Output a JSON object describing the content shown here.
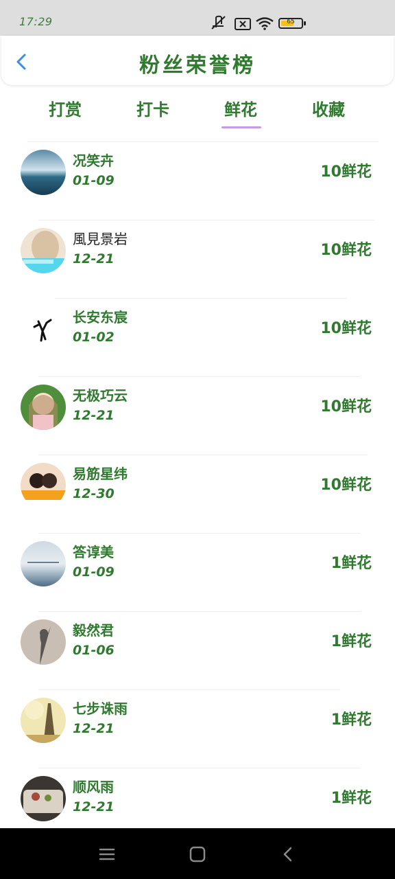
{
  "status_bar": {
    "time": "17:29",
    "battery_level": 65,
    "battery_text": "65",
    "icons": [
      "mute-icon",
      "no-sim-icon",
      "wifi-icon",
      "battery-icon"
    ]
  },
  "header": {
    "title": "粉丝荣誉榜",
    "back_icon": "chevron-left-icon"
  },
  "tabs": [
    {
      "label": "打赏",
      "active": false
    },
    {
      "label": "打卡",
      "active": false
    },
    {
      "label": "鲜花",
      "active": true
    },
    {
      "label": "收藏",
      "active": false
    }
  ],
  "fans": [
    {
      "name": "况笑卉",
      "date": "01-09",
      "amount": "10鲜花"
    },
    {
      "name": "風見景岩",
      "date": "12-21",
      "amount": "10鲜花"
    },
    {
      "name": "长安东宸",
      "date": "01-02",
      "amount": "10鲜花"
    },
    {
      "name": "无极巧云",
      "date": "12-21",
      "amount": "10鲜花"
    },
    {
      "name": "易筋星纬",
      "date": "12-30",
      "amount": "10鲜花"
    },
    {
      "name": "答谆美",
      "date": "01-09",
      "amount": "1鲜花"
    },
    {
      "name": "毅然君",
      "date": "01-06",
      "amount": "1鲜花"
    },
    {
      "name": "七步诛雨",
      "date": "12-21",
      "amount": "1鲜花"
    },
    {
      "name": "顺风雨",
      "date": "12-21",
      "amount": "1鲜花"
    }
  ],
  "nav": {
    "menu_icon": "menu-icon",
    "home_icon": "home-icon",
    "back_icon": "back-icon"
  },
  "colors": {
    "accent_green": "#2f7a2f",
    "tab_underline": "#c39be6",
    "back_icon_blue": "#3a8ee6"
  }
}
